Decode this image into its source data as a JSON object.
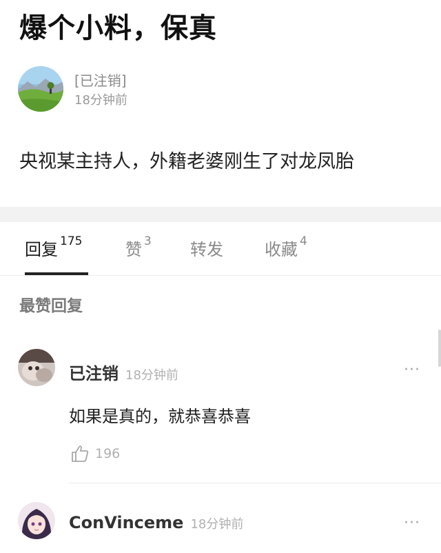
{
  "post": {
    "title": "爆个小料，保真",
    "author": "[已注销]",
    "time": "18分钟前",
    "body": "央视某主持人，外籍老婆刚生了对龙凤胎"
  },
  "tabs": [
    {
      "label": "回复",
      "count": "175",
      "active": true
    },
    {
      "label": "赞",
      "count": "3",
      "active": false
    },
    {
      "label": "转发",
      "count": "",
      "active": false
    },
    {
      "label": "收藏",
      "count": "4",
      "active": false
    }
  ],
  "best_replies_heading": "最赞回复",
  "comments": [
    {
      "user": "已注销",
      "time": "18分钟前",
      "text": "如果是真的，就恭喜恭喜",
      "likes": "196",
      "more": "···"
    },
    {
      "user": "ConVinceme",
      "time": "18分钟前",
      "more": "···"
    }
  ]
}
